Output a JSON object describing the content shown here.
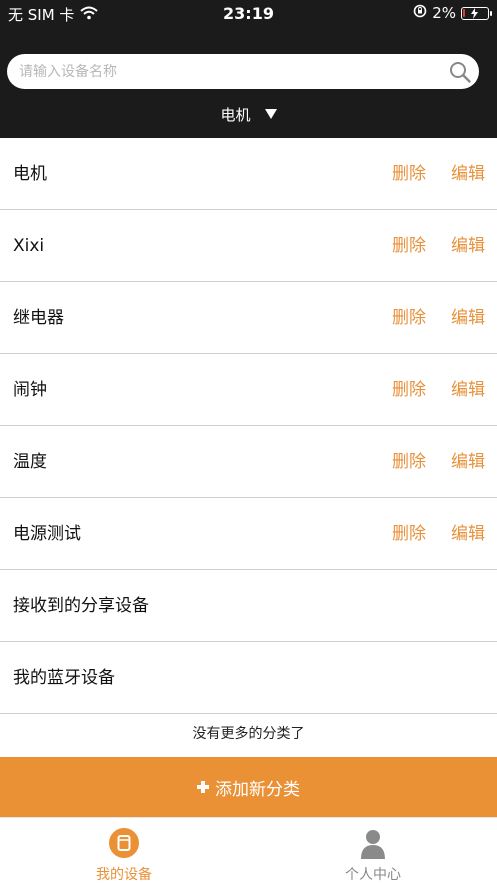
{
  "status_bar": {
    "carrier": "无 SIM 卡",
    "time": "23:19",
    "battery_percent": "2%",
    "battery_level": 0.02,
    "wifi_icon": "wifi-icon",
    "lock_icon": "rotation-lock-icon",
    "battery_color": "#e23b3b"
  },
  "search": {
    "placeholder": "请输入设备名称",
    "value": "",
    "icon": "search-icon"
  },
  "category_selector": {
    "selected": "电机",
    "icon": "dropdown-triangle-icon"
  },
  "categories": [
    {
      "name": "电机",
      "delete_label": "删除",
      "edit_label": "编辑"
    },
    {
      "name": "Xixi",
      "delete_label": "删除",
      "edit_label": "编辑"
    },
    {
      "name": "继电器",
      "delete_label": "删除",
      "edit_label": "编辑"
    },
    {
      "name": "闹钟",
      "delete_label": "删除",
      "edit_label": "编辑"
    },
    {
      "name": "温度",
      "delete_label": "删除",
      "edit_label": "编辑"
    },
    {
      "name": "电源测试",
      "delete_label": "删除",
      "edit_label": "编辑"
    },
    {
      "name": "接收到的分享设备"
    },
    {
      "name": "我的蓝牙设备"
    }
  ],
  "list_footer": "没有更多的分类了",
  "add_button": {
    "label": "添加新分类",
    "icon": "plus-icon"
  },
  "tabbar": {
    "tabs": [
      {
        "label": "我的设备",
        "icon": "my-devices-icon",
        "active": true
      },
      {
        "label": "个人中心",
        "icon": "person-icon",
        "active": false
      }
    ]
  },
  "colors": {
    "header_bg": "#1b1b1b",
    "accent": "#ea9136",
    "action_text": "#e8913a",
    "inactive_tab": "#888888"
  }
}
